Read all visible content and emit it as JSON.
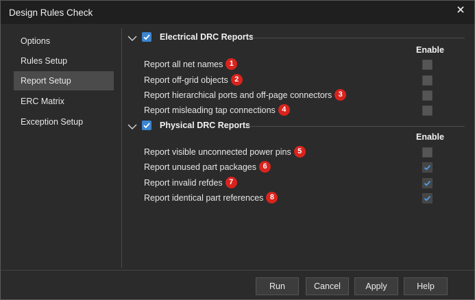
{
  "window": {
    "title": "Design Rules Check"
  },
  "sidebar": {
    "items": [
      {
        "label": "Options"
      },
      {
        "label": "Rules Setup"
      },
      {
        "label": "Report Setup"
      },
      {
        "label": "ERC Matrix"
      },
      {
        "label": "Exception Setup"
      }
    ],
    "selected": "Report Setup"
  },
  "electrical": {
    "title": "Electrical DRC Reports",
    "checked": true,
    "enable_header": "Enable",
    "rows": [
      {
        "label": "Report all net names",
        "badge": "1",
        "enabled": false
      },
      {
        "label": "Report off-grid objects",
        "badge": "2",
        "enabled": false
      },
      {
        "label": "Report hierarchical ports and off-page connectors",
        "badge": "3",
        "enabled": false
      },
      {
        "label": "Report misleading tap connections",
        "badge": "4",
        "enabled": false
      }
    ]
  },
  "physical": {
    "title": "Physical DRC Reports",
    "checked": true,
    "enable_header": "Enable",
    "rows": [
      {
        "label": "Report visible unconnected power pins",
        "badge": "5",
        "enabled": false
      },
      {
        "label": "Report unused part packages",
        "badge": "6",
        "enabled": true
      },
      {
        "label": "Report invalid refdes",
        "badge": "7",
        "enabled": true
      },
      {
        "label": "Report identical part references",
        "badge": "8",
        "enabled": true
      }
    ]
  },
  "buttons": {
    "run": "Run",
    "cancel": "Cancel",
    "apply": "Apply",
    "help": "Help"
  },
  "colors": {
    "accent": "#3b84d2",
    "badge": "#d9231d",
    "background": "#2b2b2b"
  }
}
